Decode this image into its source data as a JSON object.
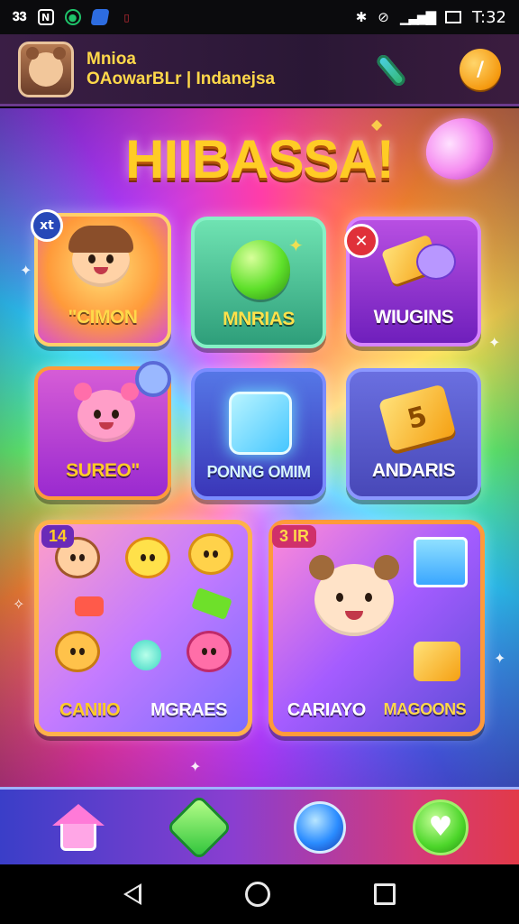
{
  "status_bar": {
    "left_icons": [
      "sim-icon",
      "nfc-icon",
      "whatsapp-icon",
      "app-icon",
      "notification-icon"
    ],
    "left_text": "𝟑𝟑",
    "right_icons": [
      "bluetooth-icon",
      "mute-icon",
      "signal-icon",
      "battery-icon"
    ],
    "time": "T:32"
  },
  "header": {
    "title": "Mnioa",
    "subtitle": "OAowarBLr | Indanejsa"
  },
  "game": {
    "title": "HIIBASSA!",
    "tiles": [
      {
        "label": "\"CIMON",
        "badge": "xt"
      },
      {
        "label": "MNRIAS"
      },
      {
        "label": "WIUGINS",
        "badge": "✕"
      },
      {
        "label": "SUREO\""
      },
      {
        "label": "PONNG OMIM"
      },
      {
        "label": "ANDARIS",
        "art_text": "5"
      }
    ],
    "big_tiles": [
      {
        "badge": "14",
        "labels": [
          "CANIIO",
          "MGRAES"
        ]
      },
      {
        "badge": "3 IR",
        "labels": [
          "CARIAYO",
          "MAGOONS"
        ]
      }
    ]
  },
  "bottom_nav": [
    "home-icon",
    "gem-icon",
    "orb-icon",
    "heart-icon"
  ],
  "colors": {
    "accent_yellow": "#ffcc25",
    "header_bg": "#2a1735",
    "nav_blue": "#3a3ec8",
    "nav_red": "#e23a48"
  }
}
